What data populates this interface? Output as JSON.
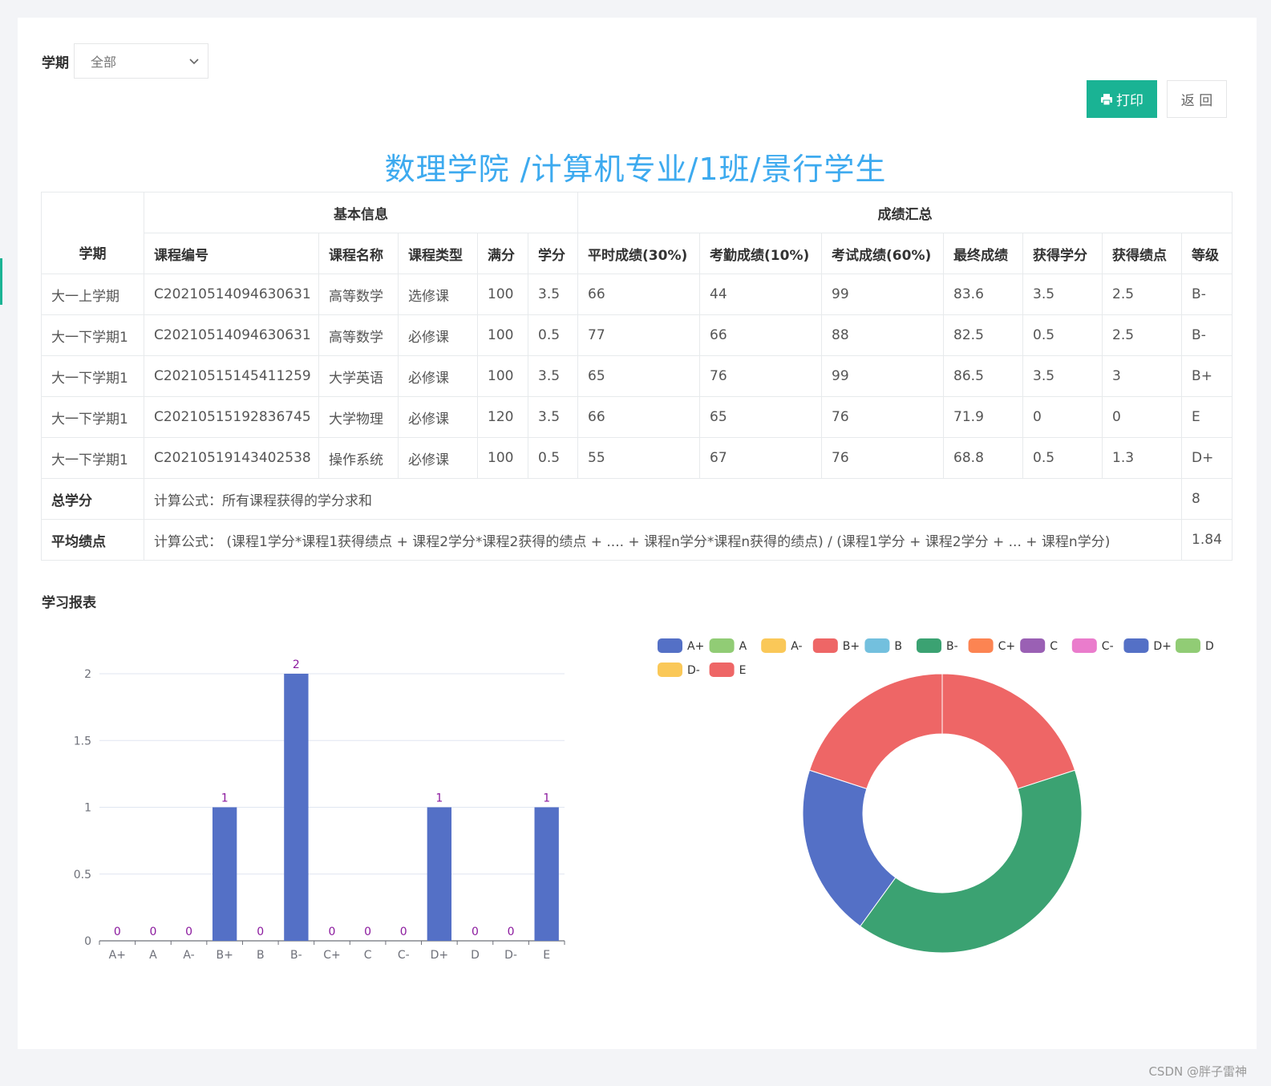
{
  "filter": {
    "label": "学期",
    "selected": "全部"
  },
  "buttons": {
    "print": "打印",
    "back": "返 回"
  },
  "title": "数理学院 /计算机专业/1班/景行学生",
  "table": {
    "group_headers": {
      "semester": "学期",
      "basic": "基本信息",
      "scores": "成绩汇总"
    },
    "columns": [
      "课程编号",
      "课程名称",
      "课程类型",
      "满分",
      "学分",
      "平时成绩(30%)",
      "考勤成绩(10%)",
      "考试成绩(60%)",
      "最终成绩",
      "获得学分",
      "获得绩点",
      "等级"
    ],
    "rows": [
      [
        "大一上学期",
        "C20210514094630631",
        "高等数学",
        "选修课",
        "100",
        "3.5",
        "66",
        "44",
        "99",
        "83.6",
        "3.5",
        "2.5",
        "B-"
      ],
      [
        "大一下学期1",
        "C20210514094630631",
        "高等数学",
        "必修课",
        "100",
        "0.5",
        "77",
        "66",
        "88",
        "82.5",
        "0.5",
        "2.5",
        "B-"
      ],
      [
        "大一下学期1",
        "C20210515145411259",
        "大学英语",
        "必修课",
        "100",
        "3.5",
        "65",
        "76",
        "99",
        "86.5",
        "3.5",
        "3",
        "B+"
      ],
      [
        "大一下学期1",
        "C20210515192836745",
        "大学物理",
        "必修课",
        "120",
        "3.5",
        "66",
        "65",
        "76",
        "71.9",
        "0",
        "0",
        "E"
      ],
      [
        "大一下学期1",
        "C20210519143402538",
        "操作系统",
        "必修课",
        "100",
        "0.5",
        "55",
        "67",
        "76",
        "68.8",
        "0.5",
        "1.3",
        "D+"
      ]
    ],
    "total_credits": {
      "label": "总学分",
      "formula": "计算公式：所有课程获得的学分求和",
      "value": "8"
    },
    "avg_gpa": {
      "label": "平均绩点",
      "formula": "计算公式： (课程1学分*课程1获得绩点 + 课程2学分*课程2获得的绩点 + .... + 课程n学分*课程n获得的绩点) / (课程1学分 + 课程2学分 + ... + 课程n学分)",
      "value": "1.84"
    }
  },
  "report_title": "学习报表",
  "watermark": "CSDN @胖子雷神",
  "colors": {
    "accent": "#1ab394",
    "title": "#3daaef",
    "bar": "#5470c6",
    "label": "#8b1a9e"
  },
  "chart_data": [
    {
      "type": "bar",
      "categories": [
        "A+",
        "A",
        "A-",
        "B+",
        "B",
        "B-",
        "C+",
        "C",
        "C-",
        "D+",
        "D",
        "D-",
        "E"
      ],
      "values": [
        0,
        0,
        0,
        1,
        0,
        2,
        0,
        0,
        0,
        1,
        0,
        0,
        1
      ],
      "yticks": [
        "0",
        "0.5",
        "1",
        "1.5",
        "2"
      ],
      "ylim": [
        0,
        2
      ],
      "grid": true
    },
    {
      "type": "pie",
      "style": "donut",
      "legend_placement": "top",
      "legend": [
        {
          "name": "A+",
          "color": "#5470c6"
        },
        {
          "name": "A",
          "color": "#91cc75"
        },
        {
          "name": "A-",
          "color": "#fac858"
        },
        {
          "name": "B+",
          "color": "#ee6666"
        },
        {
          "name": "B",
          "color": "#73c0de"
        },
        {
          "name": "B-",
          "color": "#3ba272"
        },
        {
          "name": "C+",
          "color": "#fc8452"
        },
        {
          "name": "C",
          "color": "#9a60b4"
        },
        {
          "name": "C-",
          "color": "#ea7ccc"
        },
        {
          "name": "D+",
          "color": "#5470c6"
        },
        {
          "name": "D",
          "color": "#91cc75"
        },
        {
          "name": "D-",
          "color": "#fac858"
        },
        {
          "name": "E",
          "color": "#ee6666"
        }
      ],
      "slices": [
        {
          "name": "B+",
          "value": 1,
          "color": "#ee6666"
        },
        {
          "name": "B-",
          "value": 2,
          "color": "#3ba272"
        },
        {
          "name": "D+",
          "value": 1,
          "color": "#5470c6"
        },
        {
          "name": "E",
          "value": 1,
          "color": "#ee6666"
        }
      ]
    }
  ]
}
